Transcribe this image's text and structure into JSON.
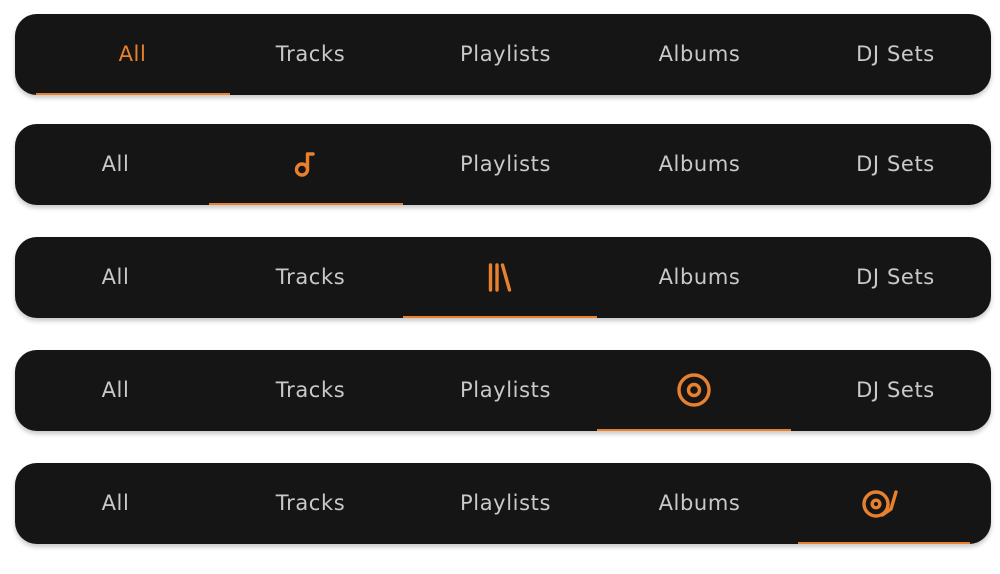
{
  "accent_color": "#e8802e",
  "bar_color": "#151515",
  "label_color": "#c9c9c9",
  "tabs": [
    "All",
    "Tracks",
    "Playlists",
    "Albums",
    "DJ Sets"
  ],
  "tab_icons": [
    "all-icon",
    "music-note-icon",
    "library-icon",
    "album-disc-icon",
    "turntable-icon"
  ],
  "bars": [
    {
      "active_tab": "All",
      "active_display": "text"
    },
    {
      "active_tab": "Tracks",
      "active_display": "icon"
    },
    {
      "active_tab": "Playlists",
      "active_display": "icon"
    },
    {
      "active_tab": "Albums",
      "active_display": "icon"
    },
    {
      "active_tab": "DJ Sets",
      "active_display": "icon"
    }
  ]
}
